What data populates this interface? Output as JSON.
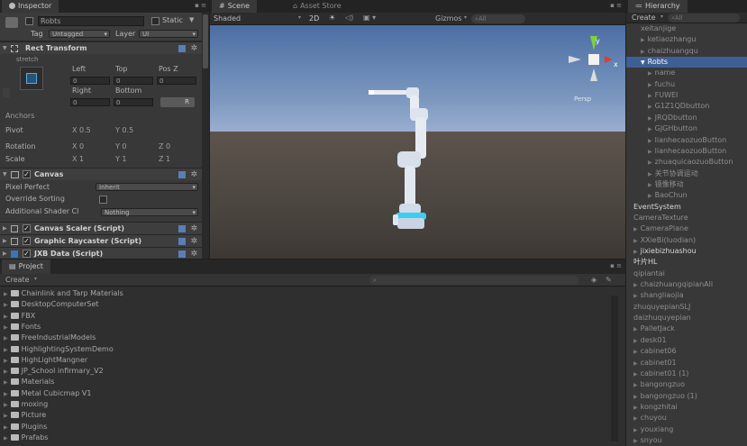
{
  "inspector": {
    "tab_label": "Inspector",
    "object_name": "Robts",
    "static_label": "Static",
    "tag_label": "Tag",
    "tag_value": "Untagged",
    "layer_label": "Layer",
    "layer_value": "UI",
    "rect_transform": {
      "title": "Rect Transform",
      "stretch_label": "stretch",
      "left_label": "Left",
      "top_label": "Top",
      "posz_label": "Pos Z",
      "left_value": "0",
      "top_value": "0",
      "posz_value": "0",
      "right_label": "Right",
      "bottom_label": "Bottom",
      "right_value": "0",
      "bottom_value": "0",
      "r_button": "R",
      "anchors_label": "Anchors",
      "pivot_label": "Pivot",
      "pivot_x": "X 0.5",
      "pivot_y": "Y 0.5",
      "rotation_label": "Rotation",
      "rot_x": "X 0",
      "rot_y": "Y 0",
      "rot_z": "Z 0",
      "scale_label": "Scale",
      "scale_x": "X 1",
      "scale_y": "Y 1",
      "scale_z": "Z 1"
    },
    "canvas": {
      "title": "Canvas",
      "pixel_perfect_label": "Pixel Perfect",
      "pixel_perfect_value": "Inherit",
      "override_sorting_label": "Override Sorting",
      "shader_label": "Additional Shader Cl",
      "shader_value": "Nothing"
    },
    "canvas_scaler": "Canvas Scaler (Script)",
    "graphic_raycaster": "Graphic Raycaster (Script)",
    "jxb_data": "JXB Data (Script)"
  },
  "scene": {
    "tab_scene": "Scene",
    "tab_asset_store": "Asset Store",
    "shaded_label": "Shaded",
    "mode_2d": "2D",
    "gizmos_label": "Gizmos",
    "search_all": "All",
    "persp_label": "Persp"
  },
  "hierarchy": {
    "tab_label": "Hierarchy",
    "create_label": "Create",
    "search_all": "All",
    "items": [
      {
        "label": "xeitanjige",
        "indent": 1,
        "arrow": false
      },
      {
        "label": "ketiaozhangu",
        "indent": 1,
        "arrow": true
      },
      {
        "label": "chaizhuangqu",
        "indent": 1,
        "arrow": true
      },
      {
        "label": "Robts",
        "indent": 1,
        "arrow": true,
        "selected": true
      },
      {
        "label": "name",
        "indent": 2,
        "arrow": true
      },
      {
        "label": "fuchu",
        "indent": 2,
        "arrow": true
      },
      {
        "label": "FUWEI",
        "indent": 2,
        "arrow": true
      },
      {
        "label": "G1Z1QDbutton",
        "indent": 2,
        "arrow": true
      },
      {
        "label": "JRQDbutton",
        "indent": 2,
        "arrow": true
      },
      {
        "label": "GJGHbutton",
        "indent": 2,
        "arrow": true
      },
      {
        "label": "lianhecaozuoButton",
        "indent": 2,
        "arrow": true
      },
      {
        "label": "lianhecaozuoButton",
        "indent": 2,
        "arrow": true
      },
      {
        "label": "zhuaquicaozuoButton",
        "indent": 2,
        "arrow": true
      },
      {
        "label": "关节协调运动",
        "indent": 2,
        "arrow": true
      },
      {
        "label": "镜像移动",
        "indent": 2,
        "arrow": true
      },
      {
        "label": "BaoChun",
        "indent": 2,
        "arrow": true
      },
      {
        "label": "EventSystem",
        "indent": 0,
        "arrow": false,
        "bright": true
      },
      {
        "label": "CameraTexture",
        "indent": 0,
        "arrow": false
      },
      {
        "label": "CameraPlane",
        "indent": 0,
        "arrow": true
      },
      {
        "label": "XXieBi(luodian)",
        "indent": 0,
        "arrow": true
      },
      {
        "label": "jixiebizhuashou",
        "indent": 0,
        "arrow": true,
        "bright": true
      },
      {
        "label": "叶片HL",
        "indent": 0,
        "arrow": false,
        "bright": true
      },
      {
        "label": "qipiantai",
        "indent": 0,
        "arrow": false
      },
      {
        "label": "chaizhuangqipianAll",
        "indent": 0,
        "arrow": true
      },
      {
        "label": "shangliaojia",
        "indent": 0,
        "arrow": true
      },
      {
        "label": "zhuquyepianSLJ",
        "indent": 0,
        "arrow": false
      },
      {
        "label": "daizhuquyepian",
        "indent": 0,
        "arrow": false
      },
      {
        "label": "PalletJack",
        "indent": 0,
        "arrow": true
      },
      {
        "label": "desk01",
        "indent": 0,
        "arrow": true
      },
      {
        "label": "cabinet06",
        "indent": 0,
        "arrow": true
      },
      {
        "label": "cabinet01",
        "indent": 0,
        "arrow": true
      },
      {
        "label": "cabinet01 (1)",
        "indent": 0,
        "arrow": true
      },
      {
        "label": "bangongzuo",
        "indent": 0,
        "arrow": true
      },
      {
        "label": "bangongzuo (1)",
        "indent": 0,
        "arrow": true
      },
      {
        "label": "kongzhitai",
        "indent": 0,
        "arrow": true
      },
      {
        "label": "chuyou",
        "indent": 0,
        "arrow": true
      },
      {
        "label": "youxiang",
        "indent": 0,
        "arrow": true
      },
      {
        "label": "snyou",
        "indent": 0,
        "arrow": true
      }
    ]
  },
  "project": {
    "tab_label": "Project",
    "create_label": "Create",
    "folders": [
      "Chainlink and Tarp Materials",
      "DesktopComputerSet",
      "FBX",
      "Fonts",
      "FreeIndustrialModels",
      "HighlightingSystemDemo",
      "HighLightMangner",
      "JP_School infirmary_V2",
      "Materials",
      "Metal Cubicmap V1",
      "moxing",
      "Picture",
      "Plugins",
      "Prafabs"
    ]
  }
}
